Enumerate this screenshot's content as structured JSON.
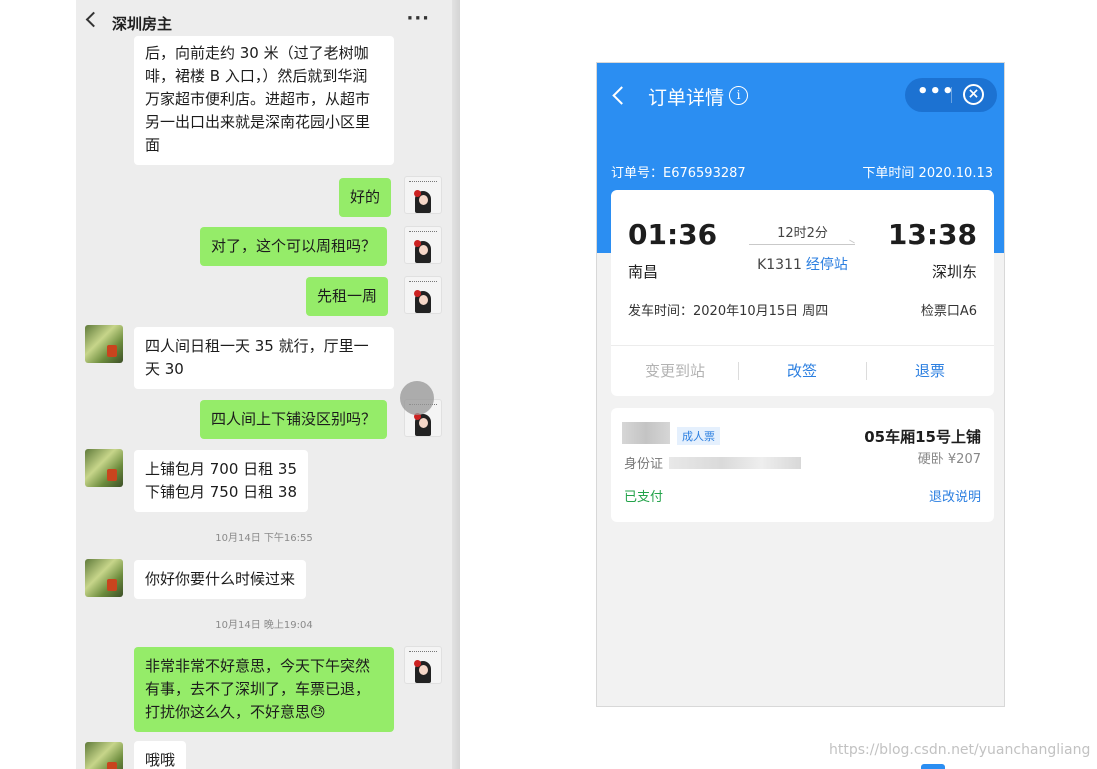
{
  "chat": {
    "title": "深圳房主",
    "more_glyph": "···",
    "messages": [
      {
        "text": "后，向前走约 30 米（过了老树咖\n啡，裙楼 B 入口，）然后就到华润\n万家超市便利店。进超市，从超市\n另一出口出来就是深南花园小区里\n面"
      },
      {
        "text": "好的"
      },
      {
        "text": "对了，这个可以周租吗？"
      },
      {
        "text": "先租一周"
      },
      {
        "text": "四人间日租一天 35 就行，厅里一\n天 30"
      },
      {
        "text": "四人间上下铺没区别吗？"
      },
      {
        "text": "上铺包月 700 日租 35\n下铺包月 750 日租 38"
      },
      {
        "text": "你好你要什么时候过来"
      },
      {
        "text": "非常非常不好意思，今天下午突然\n有事，去不了深圳了，车票已退，\n打扰你这么久，不好意思😓"
      },
      {
        "text": "哦哦"
      }
    ],
    "timestamps": [
      "10月14日 下午16:55",
      "10月14日 晚上19:04"
    ]
  },
  "order": {
    "title": "订单详情",
    "info_glyph": "i",
    "more_glyph": "•••",
    "close_glyph": "×",
    "order_no": "订单号：E676593287",
    "order_time": "下单时间   2020.10.13",
    "depart_time": "01:36",
    "arrive_time": "13:38",
    "depart_station": "南昌",
    "arrive_station": "深圳东",
    "duration": "12时2分",
    "train_no": "K1311",
    "stops_link": "经停站",
    "depart_info": "发车时间：2020年10月15日 周四",
    "gate": "检票口A6",
    "actions": {
      "change_station": "变更到站",
      "rebook": "改签",
      "refund": "退票"
    },
    "passenger": {
      "ticket_type": "成人票",
      "seat": "05车厢15号上铺",
      "id_label": "身份证",
      "berth_price": "硬卧 ¥207",
      "status": "已支付",
      "refund_note": "退改说明"
    },
    "accent_color": "#2b8ef2"
  },
  "watermark": "https://blog.csdn.net/yuanchangliang"
}
